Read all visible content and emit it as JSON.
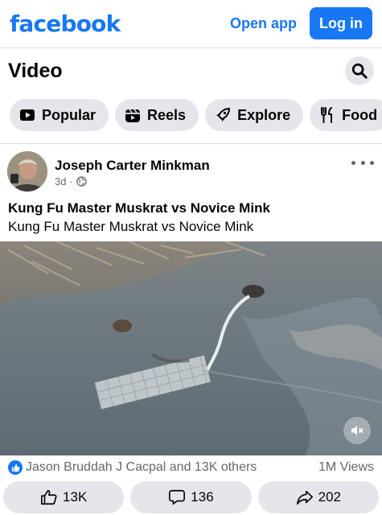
{
  "header": {
    "brand": "facebook",
    "open_app_label": "Open app",
    "login_label": "Log in"
  },
  "section": {
    "title": "Video",
    "search_icon": "search-icon"
  },
  "chips": [
    {
      "label": "Popular",
      "icon": "play-icon"
    },
    {
      "label": "Reels",
      "icon": "reels-icon"
    },
    {
      "label": "Explore",
      "icon": "rocket-icon"
    },
    {
      "label": "Food",
      "icon": "utensils-icon"
    }
  ],
  "post": {
    "author": "Joseph Carter Minkman",
    "time": "3d",
    "separator": "·",
    "privacy_icon": "globe-icon",
    "title": "Kung Fu Master Muskrat vs Novice Mink",
    "text": "Kung Fu Master Muskrat vs Novice Mink",
    "reactions_text": "Jason Bruddah J Cacpal and 13K others",
    "views": "1M Views",
    "likes": "13K",
    "comments": "136",
    "shares": "202"
  },
  "colors": {
    "brand_blue": "#1877f2",
    "chip_bg": "#e4e6eb",
    "secondary_text": "#65676b"
  }
}
